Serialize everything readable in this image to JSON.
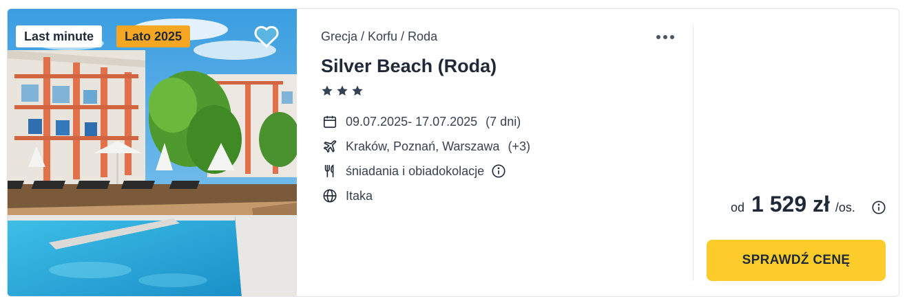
{
  "badges": {
    "last_minute": "Last minute",
    "season": "Lato 2025"
  },
  "hotel": {
    "breadcrumb": "Grecja / Korfu / Roda",
    "name": "Silver Beach (Roda)",
    "stars": 3
  },
  "details": {
    "dates": "09.07.2025- 17.07.2025",
    "duration": "(7 dni)",
    "airports": "Kraków, Poznań, Warszawa",
    "airports_more": "(+3)",
    "board": "śniadania i obiadokolacje",
    "operator": "Itaka"
  },
  "price": {
    "prefix": "od",
    "value": "1 529 zł",
    "suffix": "/os."
  },
  "cta": {
    "label": "SPRAWDŹ CENĘ"
  },
  "colors": {
    "cta_bg": "#fccd2a",
    "season_badge": "#f5a623",
    "text": "#1f2937",
    "heart": "#5fb8e0"
  },
  "icons": [
    "heart-icon",
    "more-icon",
    "star-icon",
    "calendar-icon",
    "plane-icon",
    "cutlery-icon",
    "info-icon",
    "globe-icon"
  ]
}
